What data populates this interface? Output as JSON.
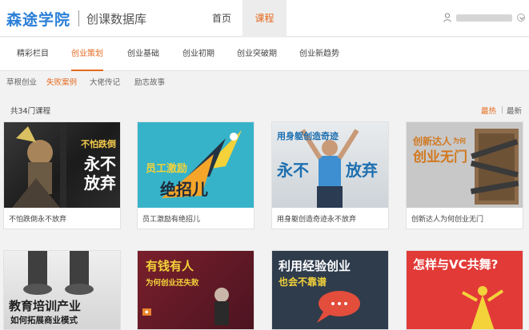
{
  "header": {
    "logo": "森途学院",
    "subtitle": "创课数据库",
    "nav": [
      {
        "label": "首页"
      },
      {
        "label": "课程"
      }
    ]
  },
  "categories": [
    "精彩栏目",
    "创业策划",
    "创业基础",
    "创业初期",
    "创业突破期",
    "创业新趋势"
  ],
  "subtabs": [
    "草根创业",
    "失败案例",
    "大佬传记",
    "励志故事"
  ],
  "count_text": "共34门课程",
  "sort": [
    "最热",
    "最新"
  ],
  "colors": {
    "accent": "#e56a1e",
    "brand": "#2b7fd6"
  },
  "courses": [
    {
      "caption": "不怕跌倒永不放弃",
      "art": {
        "lines": [
          "不怕跌倒",
          "永不",
          "放弃"
        ]
      }
    },
    {
      "caption": "员工激励有绝招儿",
      "art": {
        "lines": [
          "员工激励",
          "绝招儿"
        ]
      }
    },
    {
      "caption": "用身躯创造奇迹永不放弃",
      "art": {
        "lines": [
          "用身躯创造奇迹",
          "永不",
          "放弃"
        ]
      }
    },
    {
      "caption": "创新达人为何创业无门",
      "art": {
        "lines": [
          "创新达人",
          "为何",
          "创业无门"
        ]
      }
    },
    {
      "caption": "",
      "art": {
        "lines": [
          "教育培训产业",
          "如何拓展商业模式"
        ]
      }
    },
    {
      "caption": "",
      "art": {
        "lines": [
          "有钱有人",
          "为何创业还失败"
        ]
      }
    },
    {
      "caption": "",
      "art": {
        "lines": [
          "利用经验创业",
          "也会不靠谱"
        ]
      }
    },
    {
      "caption": "",
      "art": {
        "lines": [
          "怎样与VC共舞?"
        ]
      }
    }
  ]
}
